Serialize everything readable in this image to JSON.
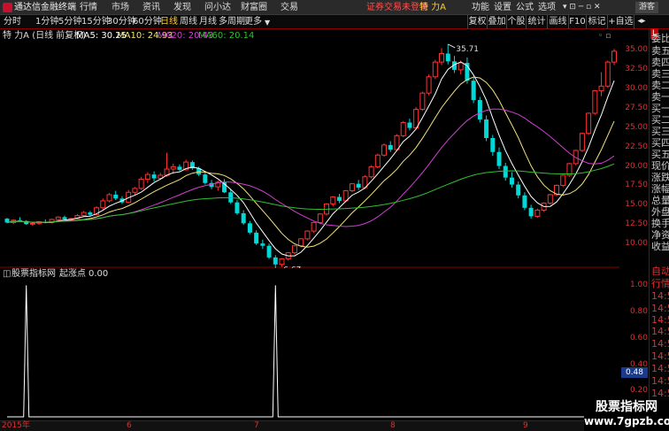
{
  "app": {
    "title": "通达信金融终端",
    "logo": "tdx-logo"
  },
  "menu": [
    "行情",
    "市场",
    "资讯",
    "发现",
    "问小达",
    "财富圈",
    "交易"
  ],
  "notice": "证券交易未登录",
  "stock_name": "特 力A",
  "top_right": [
    "功能",
    "设置",
    "公式",
    "选项"
  ],
  "guest": "游客",
  "periods": [
    "分时",
    "1分钟",
    "5分钟",
    "15分钟",
    "30分钟",
    "60分钟",
    "日线",
    "周线",
    "月线",
    "多周期",
    "更多"
  ],
  "active_period": "日线",
  "tools": [
    "复权",
    "叠加",
    "个股",
    "统计",
    "画线",
    "F10",
    "标记",
    "+自选"
  ],
  "chart": {
    "header": "特 力A (日线 前复权)",
    "ma": [
      {
        "label": "MA5: 30.25",
        "color": "#ffffff"
      },
      {
        "label": "MA10: 24.93",
        "color": "#f2e27a"
      },
      {
        "label": "MA20: 20.43",
        "color": "#d040d0"
      },
      {
        "label": "MA60: 20.14",
        "color": "#30c030"
      }
    ],
    "y_ticks": [
      "35.00",
      "32.50",
      "30.00",
      "27.50",
      "25.00",
      "22.50",
      "20.00",
      "17.50",
      "15.00",
      "12.50",
      "10.00"
    ],
    "high_label": "35.71",
    "low_label": "6.67"
  },
  "indicator": {
    "name": "股票指标网",
    "series": "起涨点",
    "value": "0.00",
    "y_ticks": [
      "1.00",
      "0.80",
      "0.60",
      "0.40",
      "0.20"
    ],
    "cursor_value": "0.48"
  },
  "x_labels": [
    "2015年",
    "6",
    "7",
    "8",
    "9"
  ],
  "side_panel": [
    "委比",
    "卖五",
    "卖四",
    "卖三",
    "卖二",
    "卖一",
    "买一",
    "买二",
    "买三",
    "买四",
    "买五",
    "现价",
    "涨跌",
    "涨幅",
    "总量",
    "外盘",
    "换手",
    "净资",
    "收益",
    "自动",
    "行情",
    "14:5",
    "14:5",
    "14:5",
    "14:5",
    "14:5",
    "14:5",
    "14:5",
    "14:5",
    "14:5",
    "14:5"
  ],
  "side_tag": "L",
  "watermark": {
    "line1": "股票指标网",
    "line2": "www.7gpzb.com"
  },
  "chart_data": {
    "type": "candlestick",
    "title": "特 力A (日线 前复权)",
    "ylim": [
      7.5,
      36.5
    ],
    "y_ticks": [
      10,
      12.5,
      15,
      17.5,
      20,
      22.5,
      25,
      27.5,
      30,
      32.5,
      35
    ],
    "x_ticks": [
      "2015年",
      "6",
      "7",
      "8",
      "9"
    ],
    "high": 35.71,
    "low": 6.67,
    "ohlc": [
      [
        13.2,
        13.3,
        12.6,
        12.7
      ],
      [
        12.7,
        13.1,
        12.5,
        13.0
      ],
      [
        13.0,
        13.4,
        12.8,
        12.9
      ],
      [
        12.9,
        13.0,
        12.4,
        12.5
      ],
      [
        12.5,
        12.8,
        12.3,
        12.6
      ],
      [
        12.6,
        12.9,
        12.4,
        12.8
      ],
      [
        12.8,
        13.1,
        12.6,
        12.7
      ],
      [
        12.7,
        13.2,
        12.6,
        13.1
      ],
      [
        13.1,
        13.5,
        13.0,
        13.4
      ],
      [
        13.4,
        13.6,
        13.0,
        13.1
      ],
      [
        13.1,
        13.3,
        12.9,
        13.2
      ],
      [
        13.2,
        13.8,
        13.1,
        13.6
      ],
      [
        13.6,
        14.2,
        13.4,
        14.0
      ],
      [
        14.0,
        14.2,
        13.5,
        13.7
      ],
      [
        13.7,
        14.8,
        13.6,
        14.6
      ],
      [
        14.6,
        15.8,
        14.4,
        15.5
      ],
      [
        15.5,
        16.5,
        15.3,
        16.3
      ],
      [
        16.3,
        16.8,
        15.6,
        15.8
      ],
      [
        15.8,
        16.1,
        15.1,
        15.3
      ],
      [
        15.3,
        16.9,
        15.2,
        16.6
      ],
      [
        16.6,
        17.3,
        16.3,
        17.1
      ],
      [
        17.1,
        18.6,
        16.9,
        18.3
      ],
      [
        18.3,
        19.2,
        17.8,
        18.9
      ],
      [
        18.9,
        19.3,
        18.0,
        18.4
      ],
      [
        18.4,
        19.1,
        18.2,
        18.8
      ],
      [
        18.8,
        21.7,
        18.6,
        19.6
      ],
      [
        19.6,
        20.3,
        19.0,
        19.9
      ],
      [
        19.9,
        20.2,
        19.3,
        19.5
      ],
      [
        19.5,
        20.8,
        19.4,
        20.5
      ],
      [
        20.5,
        20.7,
        19.5,
        19.7
      ],
      [
        19.7,
        19.9,
        18.7,
        18.9
      ],
      [
        18.9,
        19.2,
        17.6,
        17.8
      ],
      [
        17.8,
        18.2,
        17.0,
        17.3
      ],
      [
        17.3,
        18.1,
        16.8,
        17.9
      ],
      [
        17.9,
        18.3,
        16.5,
        16.6
      ],
      [
        16.6,
        17.0,
        15.1,
        15.3
      ],
      [
        15.3,
        15.6,
        13.7,
        13.9
      ],
      [
        13.9,
        14.3,
        12.4,
        12.6
      ],
      [
        12.6,
        12.9,
        11.2,
        11.4
      ],
      [
        11.4,
        11.7,
        9.8,
        10.0
      ],
      [
        10.0,
        10.5,
        9.3,
        9.7
      ],
      [
        9.7,
        10.0,
        8.0,
        8.2
      ],
      [
        8.2,
        8.5,
        6.67,
        7.3
      ],
      [
        7.3,
        8.1,
        7.0,
        8.0
      ],
      [
        8.0,
        8.9,
        7.8,
        8.8
      ],
      [
        8.8,
        9.8,
        8.6,
        9.7
      ],
      [
        9.7,
        10.7,
        9.5,
        10.6
      ],
      [
        10.6,
        11.7,
        10.4,
        11.6
      ],
      [
        11.6,
        12.8,
        11.4,
        12.7
      ],
      [
        12.7,
        13.9,
        12.5,
        13.8
      ],
      [
        13.8,
        15.2,
        13.6,
        15.1
      ],
      [
        15.1,
        16.1,
        14.8,
        16.0
      ],
      [
        16.0,
        16.4,
        15.2,
        15.5
      ],
      [
        15.5,
        16.9,
        15.3,
        16.8
      ],
      [
        16.8,
        17.8,
        16.6,
        17.7
      ],
      [
        17.7,
        18.2,
        16.9,
        17.2
      ],
      [
        17.2,
        18.8,
        17.0,
        18.6
      ],
      [
        18.6,
        20.1,
        18.4,
        19.9
      ],
      [
        19.9,
        21.6,
        19.7,
        21.4
      ],
      [
        21.4,
        22.9,
        21.2,
        22.7
      ],
      [
        22.7,
        23.2,
        21.8,
        22.1
      ],
      [
        22.1,
        24.1,
        21.9,
        23.9
      ],
      [
        23.9,
        25.8,
        23.7,
        25.6
      ],
      [
        25.6,
        26.1,
        24.6,
        24.9
      ],
      [
        24.9,
        27.6,
        24.7,
        27.3
      ],
      [
        27.3,
        29.6,
        27.1,
        29.4
      ],
      [
        29.4,
        31.8,
        29.1,
        31.5
      ],
      [
        31.5,
        33.7,
        31.2,
        33.4
      ],
      [
        33.4,
        35.2,
        33.0,
        34.5
      ],
      [
        34.5,
        35.71,
        33.1,
        33.5
      ],
      [
        33.5,
        34.2,
        32.0,
        32.4
      ],
      [
        32.4,
        33.6,
        31.8,
        33.3
      ],
      [
        33.3,
        34.0,
        30.6,
        31.0
      ],
      [
        31.0,
        31.4,
        28.1,
        28.5
      ],
      [
        28.5,
        28.9,
        25.6,
        26.0
      ],
      [
        26.0,
        26.5,
        23.2,
        23.6
      ],
      [
        23.6,
        24.0,
        21.3,
        21.8
      ],
      [
        21.8,
        22.4,
        19.6,
        20.0
      ],
      [
        20.0,
        20.4,
        18.1,
        18.5
      ],
      [
        18.5,
        19.2,
        17.2,
        17.6
      ],
      [
        17.6,
        18.0,
        15.8,
        16.2
      ],
      [
        16.2,
        16.6,
        14.3,
        14.6
      ],
      [
        14.6,
        15.0,
        13.2,
        13.5
      ],
      [
        13.5,
        14.5,
        13.3,
        14.3
      ],
      [
        14.3,
        15.3,
        14.1,
        15.2
      ],
      [
        15.2,
        16.4,
        15.0,
        16.3
      ],
      [
        16.3,
        17.6,
        16.1,
        17.5
      ],
      [
        17.5,
        18.9,
        17.3,
        18.8
      ],
      [
        18.8,
        20.4,
        18.6,
        20.3
      ],
      [
        20.3,
        22.1,
        20.1,
        22.0
      ],
      [
        22.0,
        24.3,
        21.8,
        24.2
      ],
      [
        24.2,
        26.9,
        24.0,
        26.8
      ],
      [
        26.8,
        29.8,
        26.6,
        29.7
      ],
      [
        29.7,
        32.1,
        29.0,
        30.3
      ],
      [
        30.3,
        33.6,
        30.1,
        33.4
      ],
      [
        33.4,
        35.1,
        33.0,
        34.8
      ]
    ],
    "indicator": {
      "series": "起涨点",
      "ylim": [
        0,
        1.05
      ],
      "spikes": [
        {
          "index": 3,
          "value": 1.0
        },
        {
          "index": 42,
          "value": 1.0
        }
      ]
    }
  }
}
